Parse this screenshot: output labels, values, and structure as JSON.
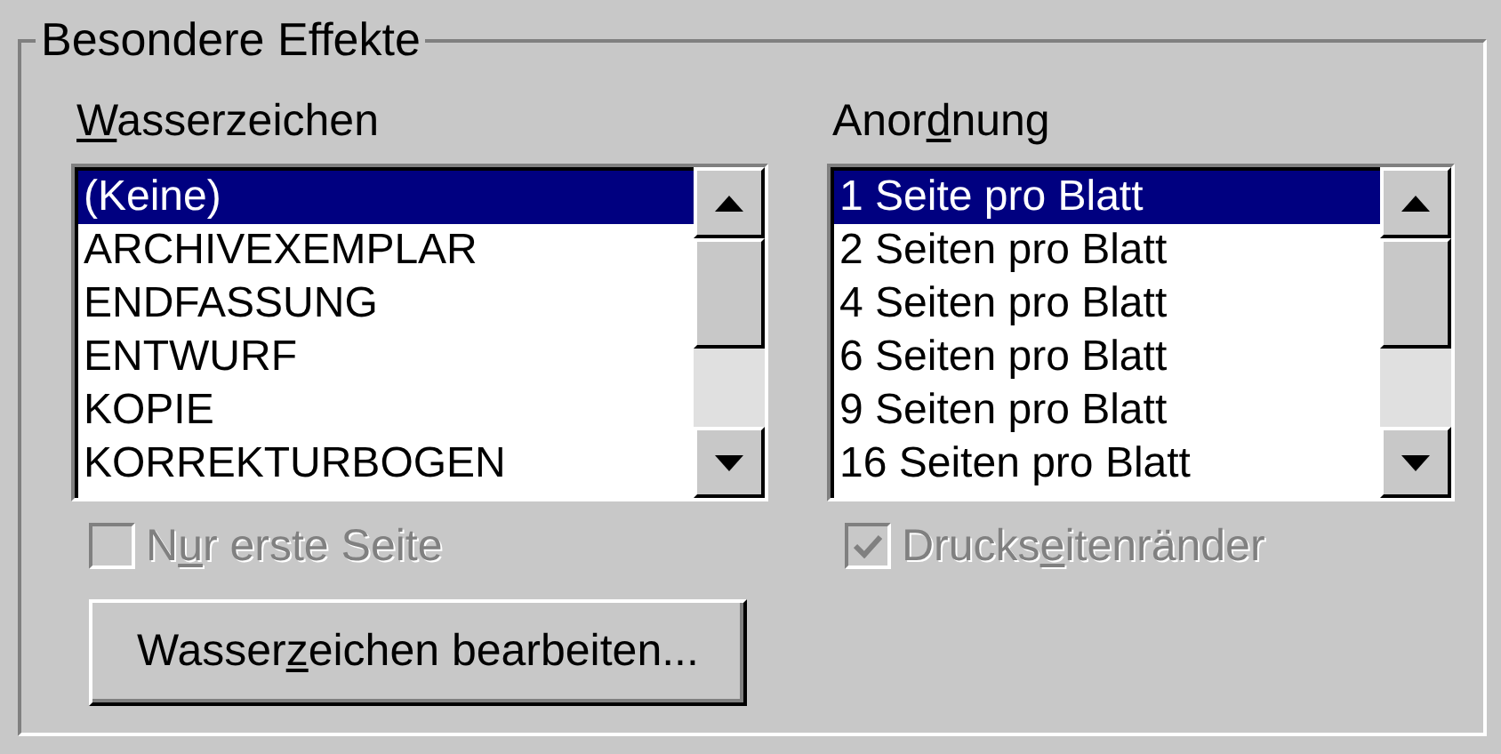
{
  "group": {
    "title": "Besondere Effekte"
  },
  "lists": [
    {
      "label": {
        "key": "W",
        "post": "asserzeichen"
      },
      "items": [
        {
          "text": "(Keine)",
          "selected": true
        },
        {
          "text": "ARCHIVEXEMPLAR",
          "selected": false
        },
        {
          "text": "ENDFASSUNG",
          "selected": false
        },
        {
          "text": "ENTWURF",
          "selected": false
        },
        {
          "text": "KOPIE",
          "selected": false
        },
        {
          "text": "KORREKTURBOGEN",
          "selected": false
        }
      ],
      "checkbox": {
        "label": {
          "pre": "N",
          "key": "u",
          "post": "r erste Seite"
        },
        "checked": false,
        "disabled": true
      }
    },
    {
      "label": {
        "pre": "Anor",
        "key": "d",
        "post": "nung"
      },
      "items": [
        {
          "text": "1 Seite pro Blatt",
          "selected": true
        },
        {
          "text": "2 Seiten pro Blatt",
          "selected": false
        },
        {
          "text": "4 Seiten pro Blatt",
          "selected": false
        },
        {
          "text": "6 Seiten pro Blatt",
          "selected": false
        },
        {
          "text": "9 Seiten pro Blatt",
          "selected": false
        },
        {
          "text": "16 Seiten pro Blatt",
          "selected": false
        }
      ],
      "checkbox": {
        "label": {
          "pre": "Drucks",
          "key": "e",
          "post": "itenränder"
        },
        "checked": true,
        "disabled": true
      }
    }
  ],
  "button": {
    "label": {
      "pre": "Wasser",
      "key": "z",
      "post": "eichen bearbeiten..."
    }
  }
}
